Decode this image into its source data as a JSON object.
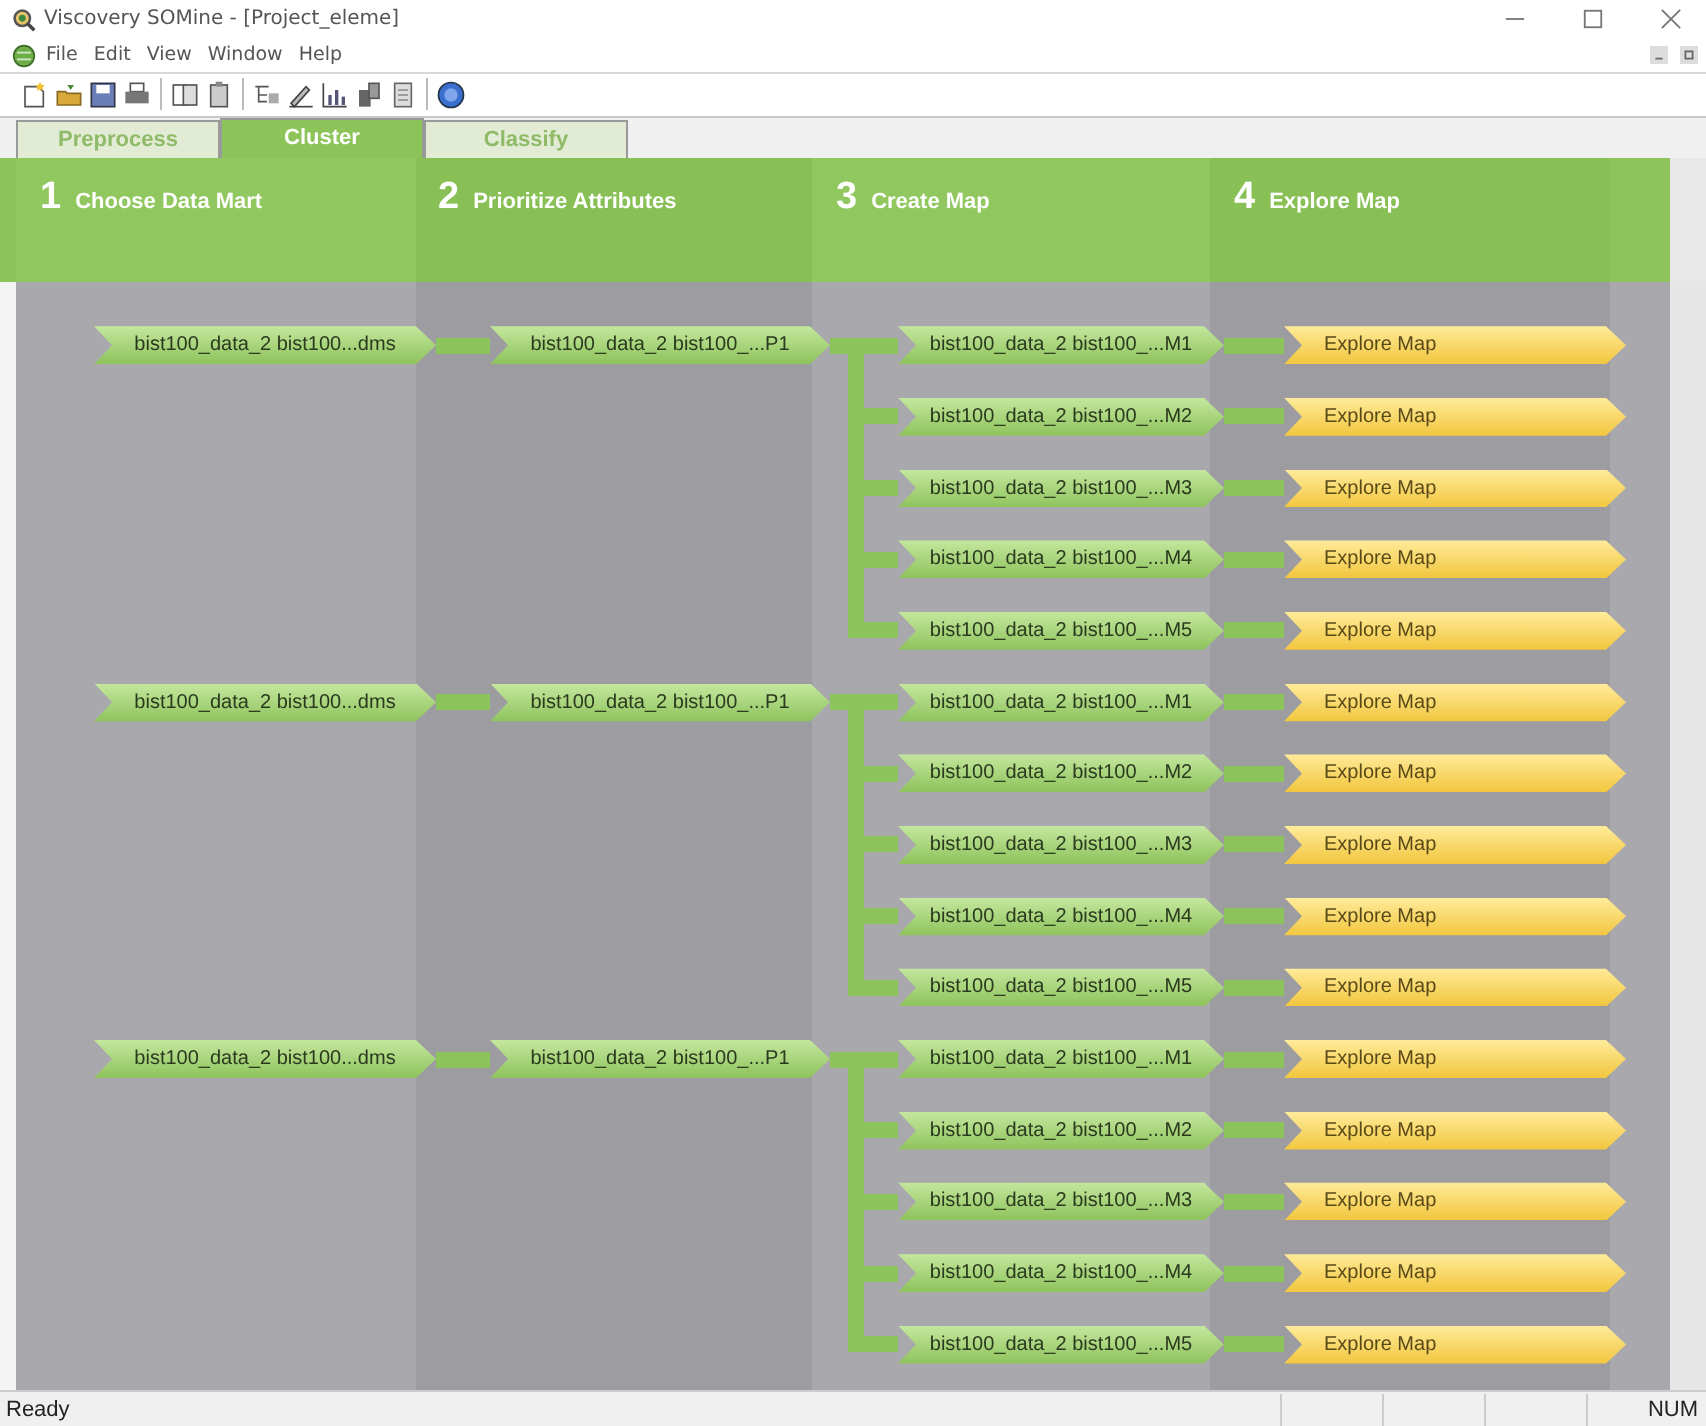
{
  "window": {
    "title": "Viscovery SOMine - [Project_eleme]"
  },
  "menu": [
    "File",
    "Edit",
    "View",
    "Window",
    "Help"
  ],
  "tabs": [
    {
      "label": "Preprocess",
      "selected": false
    },
    {
      "label": "Cluster",
      "selected": true
    },
    {
      "label": "Classify",
      "selected": false
    }
  ],
  "steps": [
    {
      "number": "1",
      "label": "Choose Data Mart"
    },
    {
      "number": "2",
      "label": "Prioritize Attributes"
    },
    {
      "number": "3",
      "label": "Create Map"
    },
    {
      "number": "4",
      "label": "Explore Map"
    }
  ],
  "groups": [
    {
      "data_mart": "bist100_data_2 bist100...dms",
      "attributes": "bist100_data_2 bist100_...P1",
      "maps": [
        {
          "name": "bist100_data_2 bist100_...M1",
          "explore": "Explore Map"
        },
        {
          "name": "bist100_data_2 bist100_...M2",
          "explore": "Explore Map"
        },
        {
          "name": "bist100_data_2 bist100_...M3",
          "explore": "Explore Map"
        },
        {
          "name": "bist100_data_2 bist100_...M4",
          "explore": "Explore Map"
        },
        {
          "name": "bist100_data_2 bist100_...M5",
          "explore": "Explore Map"
        }
      ]
    },
    {
      "data_mart": "bist100_data_2 bist100...dms",
      "attributes": "bist100_data_2 bist100_...P1",
      "maps": [
        {
          "name": "bist100_data_2 bist100_...M1",
          "explore": "Explore Map"
        },
        {
          "name": "bist100_data_2 bist100_...M2",
          "explore": "Explore Map"
        },
        {
          "name": "bist100_data_2 bist100_...M3",
          "explore": "Explore Map"
        },
        {
          "name": "bist100_data_2 bist100_...M4",
          "explore": "Explore Map"
        },
        {
          "name": "bist100_data_2 bist100_...M5",
          "explore": "Explore Map"
        }
      ]
    },
    {
      "data_mart": "bist100_data_2 bist100...dms",
      "attributes": "bist100_data_2 bist100_...P1",
      "maps": [
        {
          "name": "bist100_data_2 bist100_...M1",
          "explore": "Explore Map"
        },
        {
          "name": "bist100_data_2 bist100_...M2",
          "explore": "Explore Map"
        },
        {
          "name": "bist100_data_2 bist100_...M3",
          "explore": "Explore Map"
        },
        {
          "name": "bist100_data_2 bist100_...M4",
          "explore": "Explore Map"
        },
        {
          "name": "bist100_data_2 bist100_...M5",
          "explore": "Explore Map"
        }
      ]
    }
  ],
  "status_bar": {
    "message": "Ready",
    "num": "NUM"
  }
}
